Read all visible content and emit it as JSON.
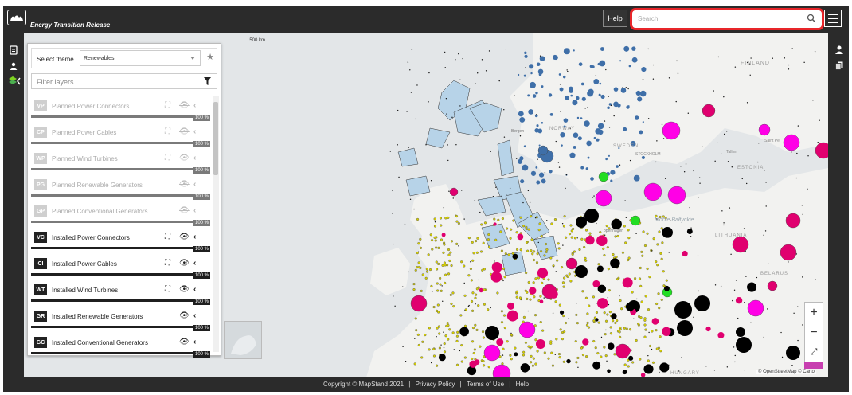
{
  "header": {
    "title": "Energy Transition Release",
    "help_label": "Help",
    "search_placeholder": "Search"
  },
  "theme": {
    "label": "Select theme",
    "selected": "Renewables"
  },
  "filter": {
    "placeholder": "Filter layers"
  },
  "layers": [
    {
      "code": "VP",
      "name": "Planned Power Connectors",
      "opacity": "100 %",
      "active": false
    },
    {
      "code": "CP",
      "name": "Planned Power Cables",
      "opacity": "100 %",
      "active": false
    },
    {
      "code": "WP",
      "name": "Planned Wind Turbines",
      "opacity": "100 %",
      "active": false
    },
    {
      "code": "PG",
      "name": "Planned Renewable Generators",
      "opacity": "100 %",
      "active": false
    },
    {
      "code": "GP",
      "name": "Planned Conventional Generators",
      "opacity": "100 %",
      "active": false
    },
    {
      "code": "VC",
      "name": "Installed Power Connectors",
      "opacity": "100 %",
      "active": true
    },
    {
      "code": "CI",
      "name": "Installed Power Cables",
      "opacity": "100 %",
      "active": true
    },
    {
      "code": "WT",
      "name": "Installed Wind Turbines",
      "opacity": "100 %",
      "active": true
    },
    {
      "code": "GR",
      "name": "Installed Renewable Generators",
      "opacity": "100 %",
      "active": true
    },
    {
      "code": "GC",
      "name": "Installed Conventional Generators",
      "opacity": "100 %",
      "active": true
    }
  ],
  "map": {
    "scale_label": "500 km",
    "place_labels": [
      "FINLAND",
      "Bergen",
      "NORWAY",
      "SWEDEN",
      "STOCKHOLM",
      "Tallinn",
      "Saint Pe",
      "ESTONIA",
      "Morze Bałtyckie",
      "openhagen",
      "LITHUANIA",
      "BELARUS",
      "HUNGARY"
    ],
    "attribution": "© OpenStreetMap © Carto"
  },
  "footer": {
    "copyright": "Copyright © MapStand 2021",
    "privacy": "Privacy Policy",
    "terms": "Terms of Use",
    "help": "Help",
    "separator": "|"
  },
  "colors": {
    "chrome": "#2b2b2b",
    "search_highlight": "#e8262a",
    "wind_marker": "#e0006f",
    "conventional_marker": "#000000",
    "renewable_marker": "#ff00e6",
    "turbine_marker": "#d7d000",
    "hydro_marker": "#3f6fa8",
    "green_marker": "#22dd22",
    "offshore_zone": "#b7d3e8"
  }
}
